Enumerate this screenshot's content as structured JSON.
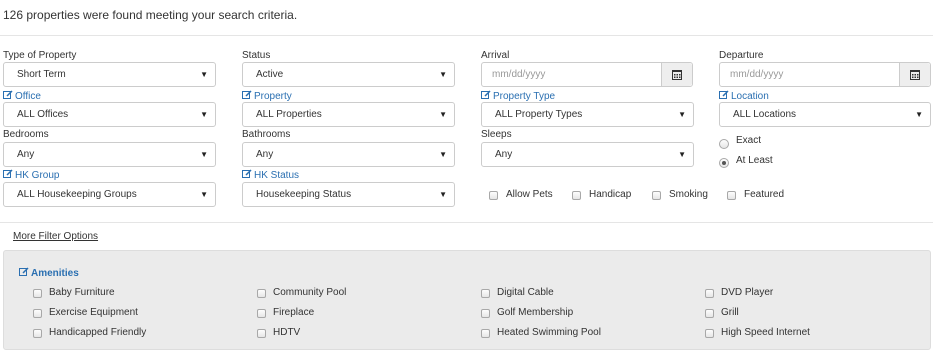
{
  "result_text": "126 properties were found meeting your search criteria.",
  "filters": {
    "type_of_property": {
      "label": "Type of Property",
      "value": "Short Term"
    },
    "status": {
      "label": "Status",
      "value": "Active"
    },
    "arrival": {
      "label": "Arrival",
      "placeholder": "mm/dd/yyyy"
    },
    "departure": {
      "label": "Departure",
      "placeholder": "mm/dd/yyyy"
    },
    "office": {
      "label": "Office",
      "value": "ALL Offices"
    },
    "property": {
      "label": "Property",
      "value": "ALL Properties"
    },
    "property_type": {
      "label": "Property Type",
      "value": "ALL Property Types"
    },
    "location": {
      "label": "Location",
      "value": "ALL Locations"
    },
    "bedrooms": {
      "label": "Bedrooms",
      "value": "Any"
    },
    "bathrooms": {
      "label": "Bathrooms",
      "value": "Any"
    },
    "sleeps": {
      "label": "Sleeps",
      "value": "Any"
    },
    "sleeps_mode": {
      "exact": "Exact",
      "at_least": "At Least",
      "selected": "At Least"
    },
    "hk_group": {
      "label": "HK Group",
      "value": "ALL Housekeeping Groups"
    },
    "hk_status": {
      "label": "HK Status",
      "value": "Housekeeping Status"
    },
    "checkboxes": {
      "allow_pets": "Allow Pets",
      "handicap": "Handicap",
      "smoking": "Smoking",
      "featured": "Featured"
    }
  },
  "more_filter_options": "More Filter Options",
  "amenities": {
    "title": "Amenities",
    "items": [
      "Baby Furniture",
      "Community Pool",
      "Digital Cable",
      "DVD Player",
      "Exercise Equipment",
      "Fireplace",
      "Golf Membership",
      "Grill",
      "Handicapped Friendly",
      "HDTV",
      "Heated Swimming Pool",
      "High Speed Internet"
    ]
  },
  "icons": {
    "edit": "edit-icon",
    "calendar": "calendar-icon",
    "dropdown": "chevron-down-icon"
  },
  "colors": {
    "link": "#2a6fb1",
    "panel_bg": "#ebebeb",
    "border": "#cccccc"
  }
}
